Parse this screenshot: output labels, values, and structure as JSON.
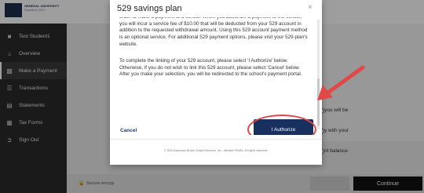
{
  "header": {
    "logo_line1": "GENERAL UNIVERSITY",
    "logo_line2": "Founded in 1911"
  },
  "sidebar": {
    "items": [
      {
        "label": "Test Student1",
        "icon": "user-icon"
      },
      {
        "label": "Overview",
        "icon": "home-icon"
      },
      {
        "label": "Make a Payment",
        "icon": "card-icon",
        "active": true
      },
      {
        "label": "Transactions",
        "icon": "list-icon"
      },
      {
        "label": "Statements",
        "icon": "document-icon"
      },
      {
        "label": "Tax Forms",
        "icon": "tax-form-icon"
      },
      {
        "label": "Sign Out",
        "icon": "sign-out-icon"
      }
    ]
  },
  "background": {
    "frag_will_be": "you will be",
    "frag_with_your": "y with your",
    "frag_balance": "nt balance",
    "secure_text": "Secure encryp",
    "continue_label": "Continue"
  },
  "modal": {
    "title": "529 savings plan",
    "close_label": "×",
    "paragraph1": "order to make a payment to a school. When you authorize a payment to the school, you will incur a service fee of $10.00 that will be deducted from your 529 account in addition to the requested withdrawal amount. Using this 529 account payment method is an optional service. For additional 529 payment options, please visit your 529 plan's website.",
    "paragraph2": "To complete the linking of your 529 account, please select 'I Authorize' below. Otherwise, if you do not wish to link this 529 account, please select 'Cancel' below. After you make your selection, you will be redirected to the school's payment portal.",
    "cancel_label": "Cancel",
    "authorize_label": "I Authorize",
    "footer_text": "© 2020 Ascensus Broker Dealer Services, Inc., Member FINRA. All rights reserved."
  },
  "annotation": {
    "color": "#e04848"
  }
}
